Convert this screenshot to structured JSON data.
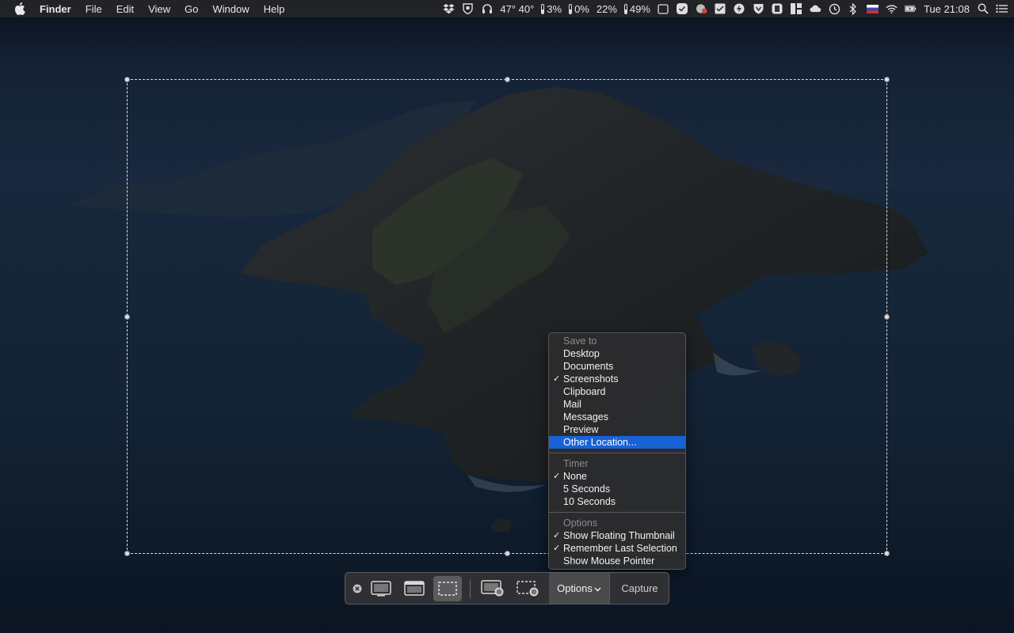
{
  "menubar": {
    "app_name": "Finder",
    "items": [
      "File",
      "Edit",
      "View",
      "Go",
      "Window",
      "Help"
    ],
    "status": {
      "temps": "47° 40°",
      "cpu": "3%",
      "gpu": "0%",
      "mem1": "22%",
      "mem2": "49%",
      "clock": "Tue 21:08"
    }
  },
  "options_menu": {
    "save_to": {
      "header": "Save to",
      "items": [
        {
          "label": "Desktop",
          "checked": false
        },
        {
          "label": "Documents",
          "checked": false
        },
        {
          "label": "Screenshots",
          "checked": true
        },
        {
          "label": "Clipboard",
          "checked": false
        },
        {
          "label": "Mail",
          "checked": false
        },
        {
          "label": "Messages",
          "checked": false
        },
        {
          "label": "Preview",
          "checked": false
        },
        {
          "label": "Other Location...",
          "checked": false,
          "highlighted": true
        }
      ]
    },
    "timer": {
      "header": "Timer",
      "items": [
        {
          "label": "None",
          "checked": true
        },
        {
          "label": "5 Seconds",
          "checked": false
        },
        {
          "label": "10 Seconds",
          "checked": false
        }
      ]
    },
    "options": {
      "header": "Options",
      "items": [
        {
          "label": "Show Floating Thumbnail",
          "checked": true
        },
        {
          "label": "Remember Last Selection",
          "checked": true
        },
        {
          "label": "Show Mouse Pointer",
          "checked": false
        }
      ]
    },
    "check_glyph": "✓"
  },
  "toolbar": {
    "options_label": "Options",
    "capture_label": "Capture"
  },
  "colors": {
    "highlight": "#1762d5",
    "menu_bg": "#2c2c2e"
  }
}
